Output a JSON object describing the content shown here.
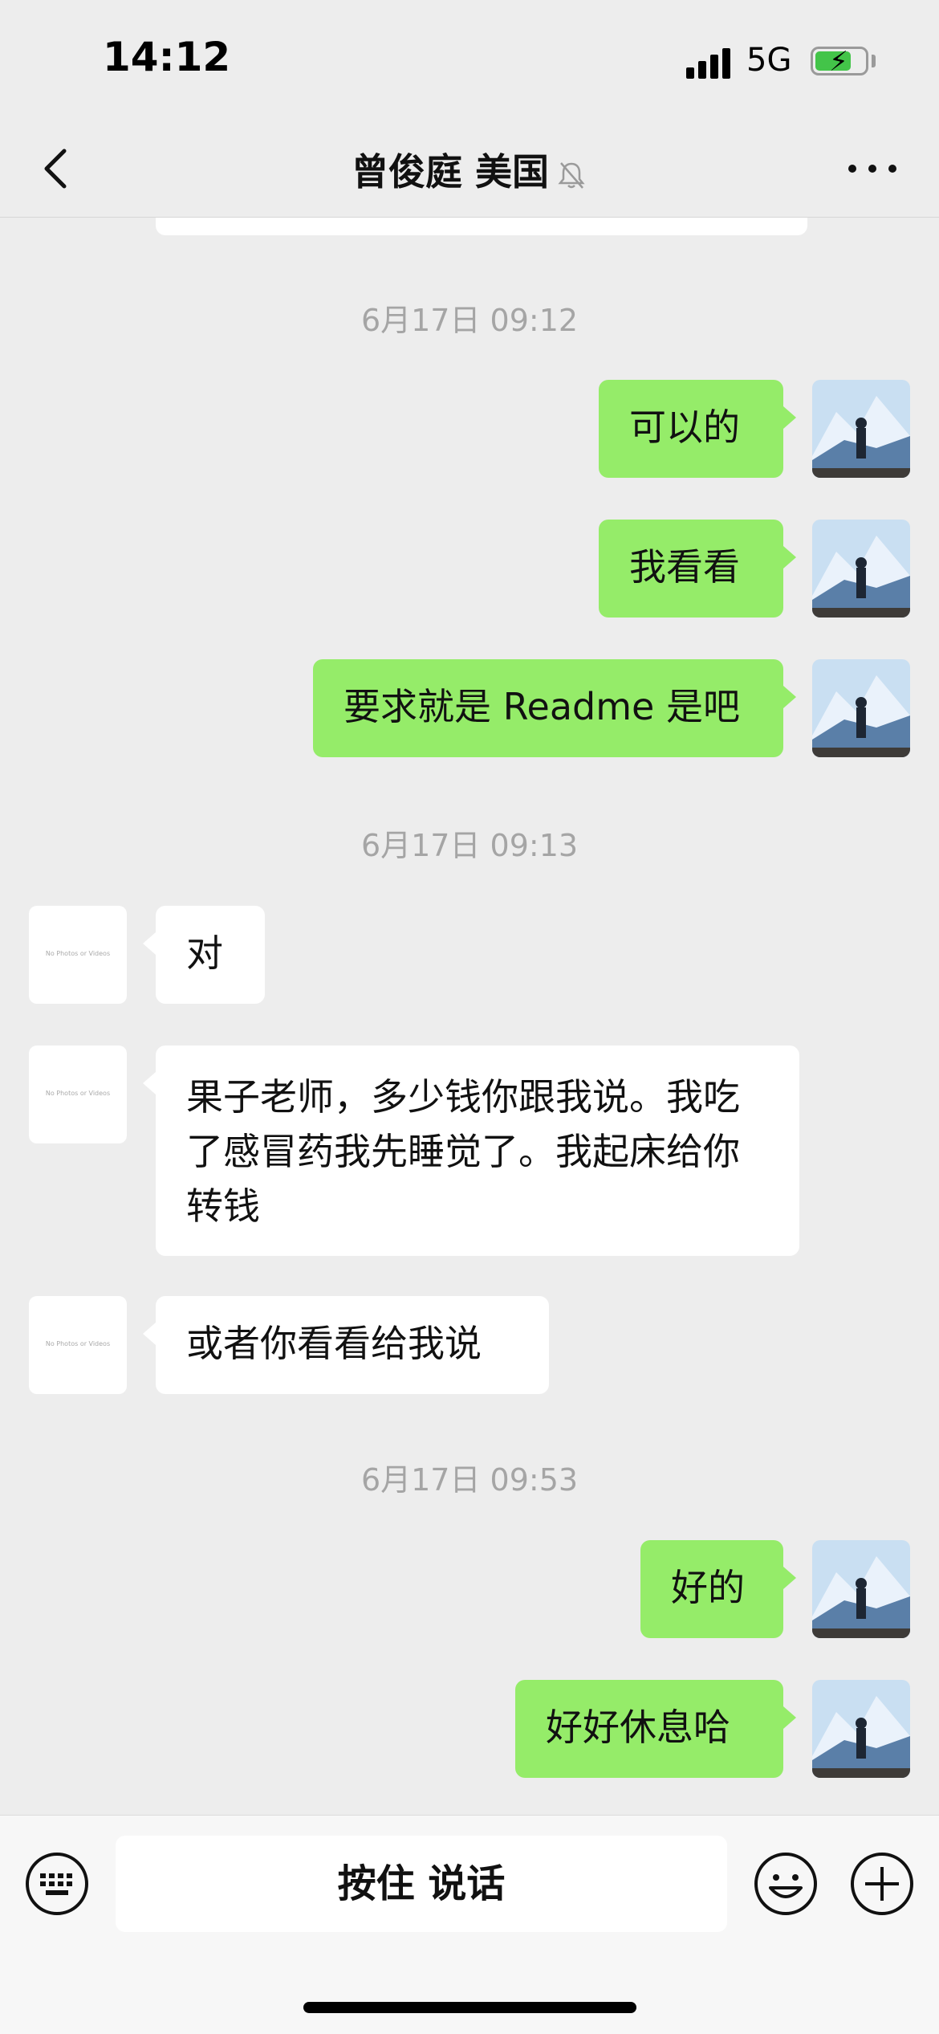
{
  "status_bar": {
    "time": "14:12",
    "network": "5G"
  },
  "header": {
    "title": "曾俊庭 美国"
  },
  "messages": {
    "ts1": "6月17日 09:12",
    "m1": "可以的",
    "m2": "我看看",
    "m3": "要求就是 Readme 是吧",
    "ts2": "6月17日 09:13",
    "m4": "对",
    "m5": "果子老师，多少钱你跟我说。我吃了感冒药我先睡觉了。我起床给你转钱",
    "m6": "或者你看看给我说",
    "ts3": "6月17日 09:53",
    "m7": "好的",
    "m8": "好好休息哈"
  },
  "avatar_placeholder": "No Photos or Videos",
  "input_bar": {
    "voice_label": "按住 说话"
  },
  "colors": {
    "self_bubble": "#95ec69",
    "other_bubble": "#ffffff",
    "background": "#ededed"
  }
}
